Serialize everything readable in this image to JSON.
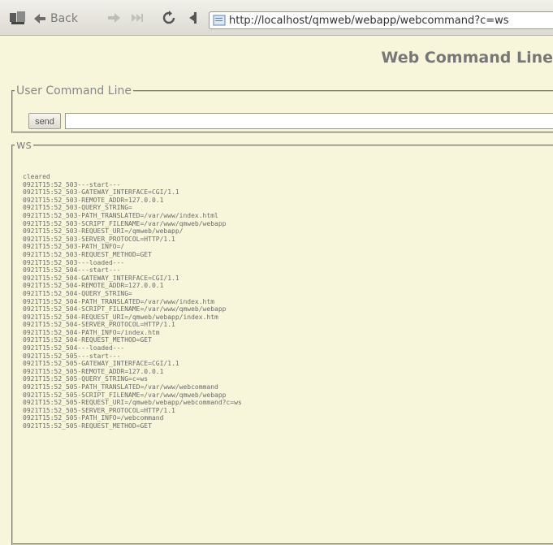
{
  "toolbar": {
    "back_label": "Back",
    "url": "http://localhost/qmweb/webapp/webcommand?c=ws"
  },
  "icons": {
    "logo": "program-icon",
    "back": "back-arrow-icon",
    "forward": "forward-arrow-icon",
    "end": "end-icon",
    "reload": "reload-icon",
    "bookmark": "bookmark-icon",
    "page": "page-icon"
  },
  "page": {
    "title": "Web Command Line"
  },
  "command_panel": {
    "legend": "User Command Line",
    "send_label": "send",
    "input_value": ""
  },
  "log_panel": {
    "legend": "ws",
    "lines": [
      "cleared",
      "0921T15:52_503---start---",
      "0921T15:52_503-GATEWAY_INTERFACE=CGI/1.1",
      "0921T15:52_503-REMOTE_ADDR=127.0.0.1",
      "0921T15:52_503-QUERY_STRING=",
      "0921T15:52_503-PATH_TRANSLATED=/var/www/index.html",
      "0921T15:52_503-SCRIPT_FILENAME=/var/www/qmweb/webapp",
      "0921T15:52_503-REQUEST_URI=/qmweb/webapp/",
      "0921T15:52_503-SERVER_PROTOCOL=HTTP/1.1",
      "0921T15:52_503-PATH_INFO=/",
      "0921T15:52_503-REQUEST_METHOD=GET",
      "0921T15:52_503---loaded---",
      "0921T15:52_504---start---",
      "0921T15:52_504-GATEWAY_INTERFACE=CGI/1.1",
      "0921T15:52_504-REMOTE_ADDR=127.0.0.1",
      "0921T15:52_504-QUERY_STRING=",
      "0921T15:52_504-PATH_TRANSLATED=/var/www/index.htm",
      "0921T15:52_504-SCRIPT_FILENAME=/var/www/qmweb/webapp",
      "0921T15:52_504-REQUEST_URI=/qmweb/webapp/index.htm",
      "0921T15:52_504-SERVER_PROTOCOL=HTTP/1.1",
      "0921T15:52_504-PATH_INFO=/index.htm",
      "0921T15:52_504-REQUEST_METHOD=GET",
      "0921T15:52_504---loaded---",
      "0921T15:52_505---start---",
      "0921T15:52_505-GATEWAY_INTERFACE=CGI/1.1",
      "0921T15:52_505-REMOTE_ADDR=127.0.0.1",
      "0921T15:52_505-QUERY_STRING=c=ws",
      "0921T15:52_505-PATH_TRANSLATED=/var/www/webcommand",
      "0921T15:52_505-SCRIPT_FILENAME=/var/www/qmweb/webapp",
      "0921T15:52_505-REQUEST_URI=/qmweb/webapp/webcommand?c=ws",
      "0921T15:52_505-SERVER_PROTOCOL=HTTP/1.1",
      "0921T15:52_505-PATH_INFO=/webcommand",
      "0921T15:52_505-REQUEST_METHOD=GET"
    ]
  },
  "colors": {
    "background": "#f7f6da",
    "title": "#777777",
    "log_text": "#6b6b6b"
  }
}
